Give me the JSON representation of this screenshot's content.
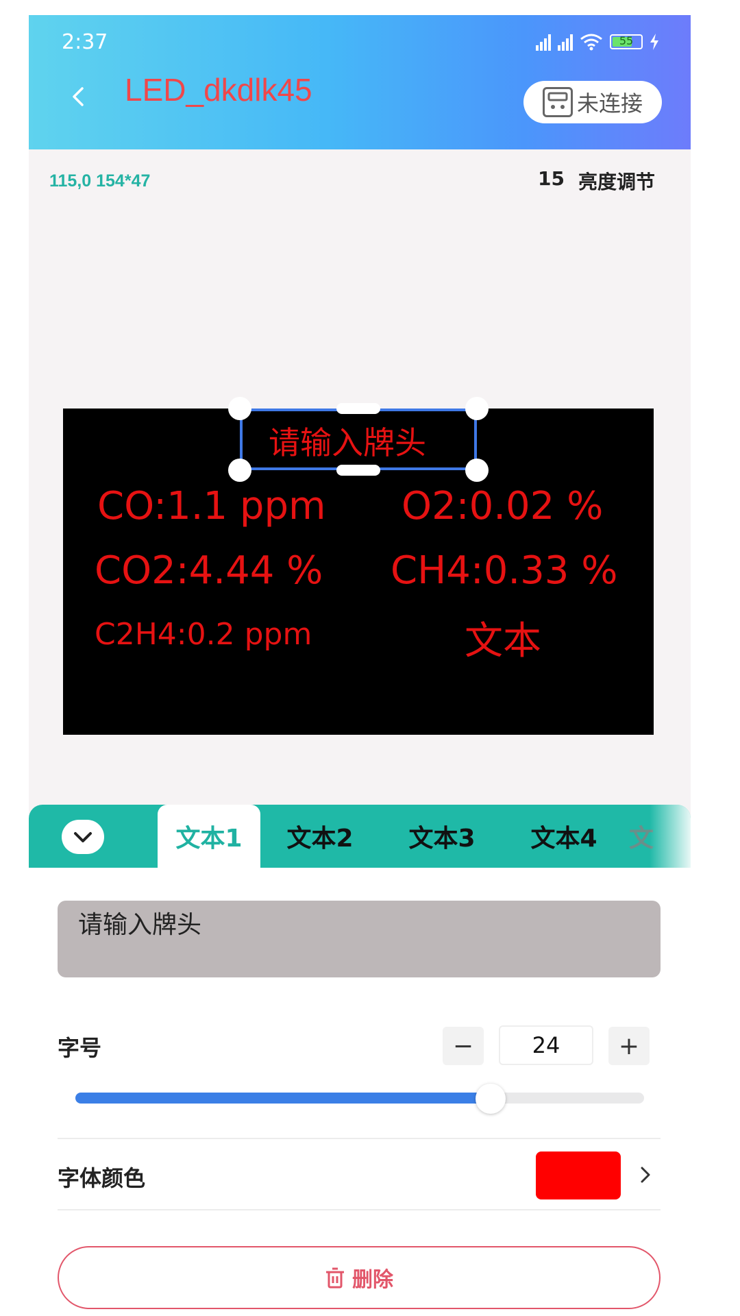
{
  "status_bar": {
    "time": "2:37",
    "battery": "55"
  },
  "header": {
    "title": "LED_dkdlk45",
    "connect_label": "未连接"
  },
  "info": {
    "coords": "115,0 154*47",
    "brightness_value": "15",
    "brightness_label": "亮度调节"
  },
  "led_screen": {
    "header_text": "请输入牌头",
    "lines": [
      {
        "text": "CO:1.1 ppm"
      },
      {
        "text": "O2:0.02 %"
      },
      {
        "text": "CO2:4.44 %"
      },
      {
        "text": "CH4:0.33 %"
      },
      {
        "text": "C2H4:0.2 ppm"
      },
      {
        "text": "文本"
      }
    ],
    "text_color": "#e61212",
    "background": "#000000"
  },
  "tabs": [
    {
      "label": "文本1",
      "active": true
    },
    {
      "label": "文本2"
    },
    {
      "label": "文本3"
    },
    {
      "label": "文本4"
    },
    {
      "label": "文"
    }
  ],
  "editor": {
    "text_value": "请输入牌头",
    "font_size_label": "字号",
    "font_size_value": "24",
    "minus": "−",
    "plus": "+",
    "slider_fraction": 0.73,
    "font_color_label": "字体颜色",
    "font_color": "#ff0000",
    "delete_label": "删除"
  },
  "colors": {
    "accent": "#1fb9a7",
    "title": "#f0474a",
    "slider": "#3b7fe6",
    "delete": "#e2566a"
  }
}
